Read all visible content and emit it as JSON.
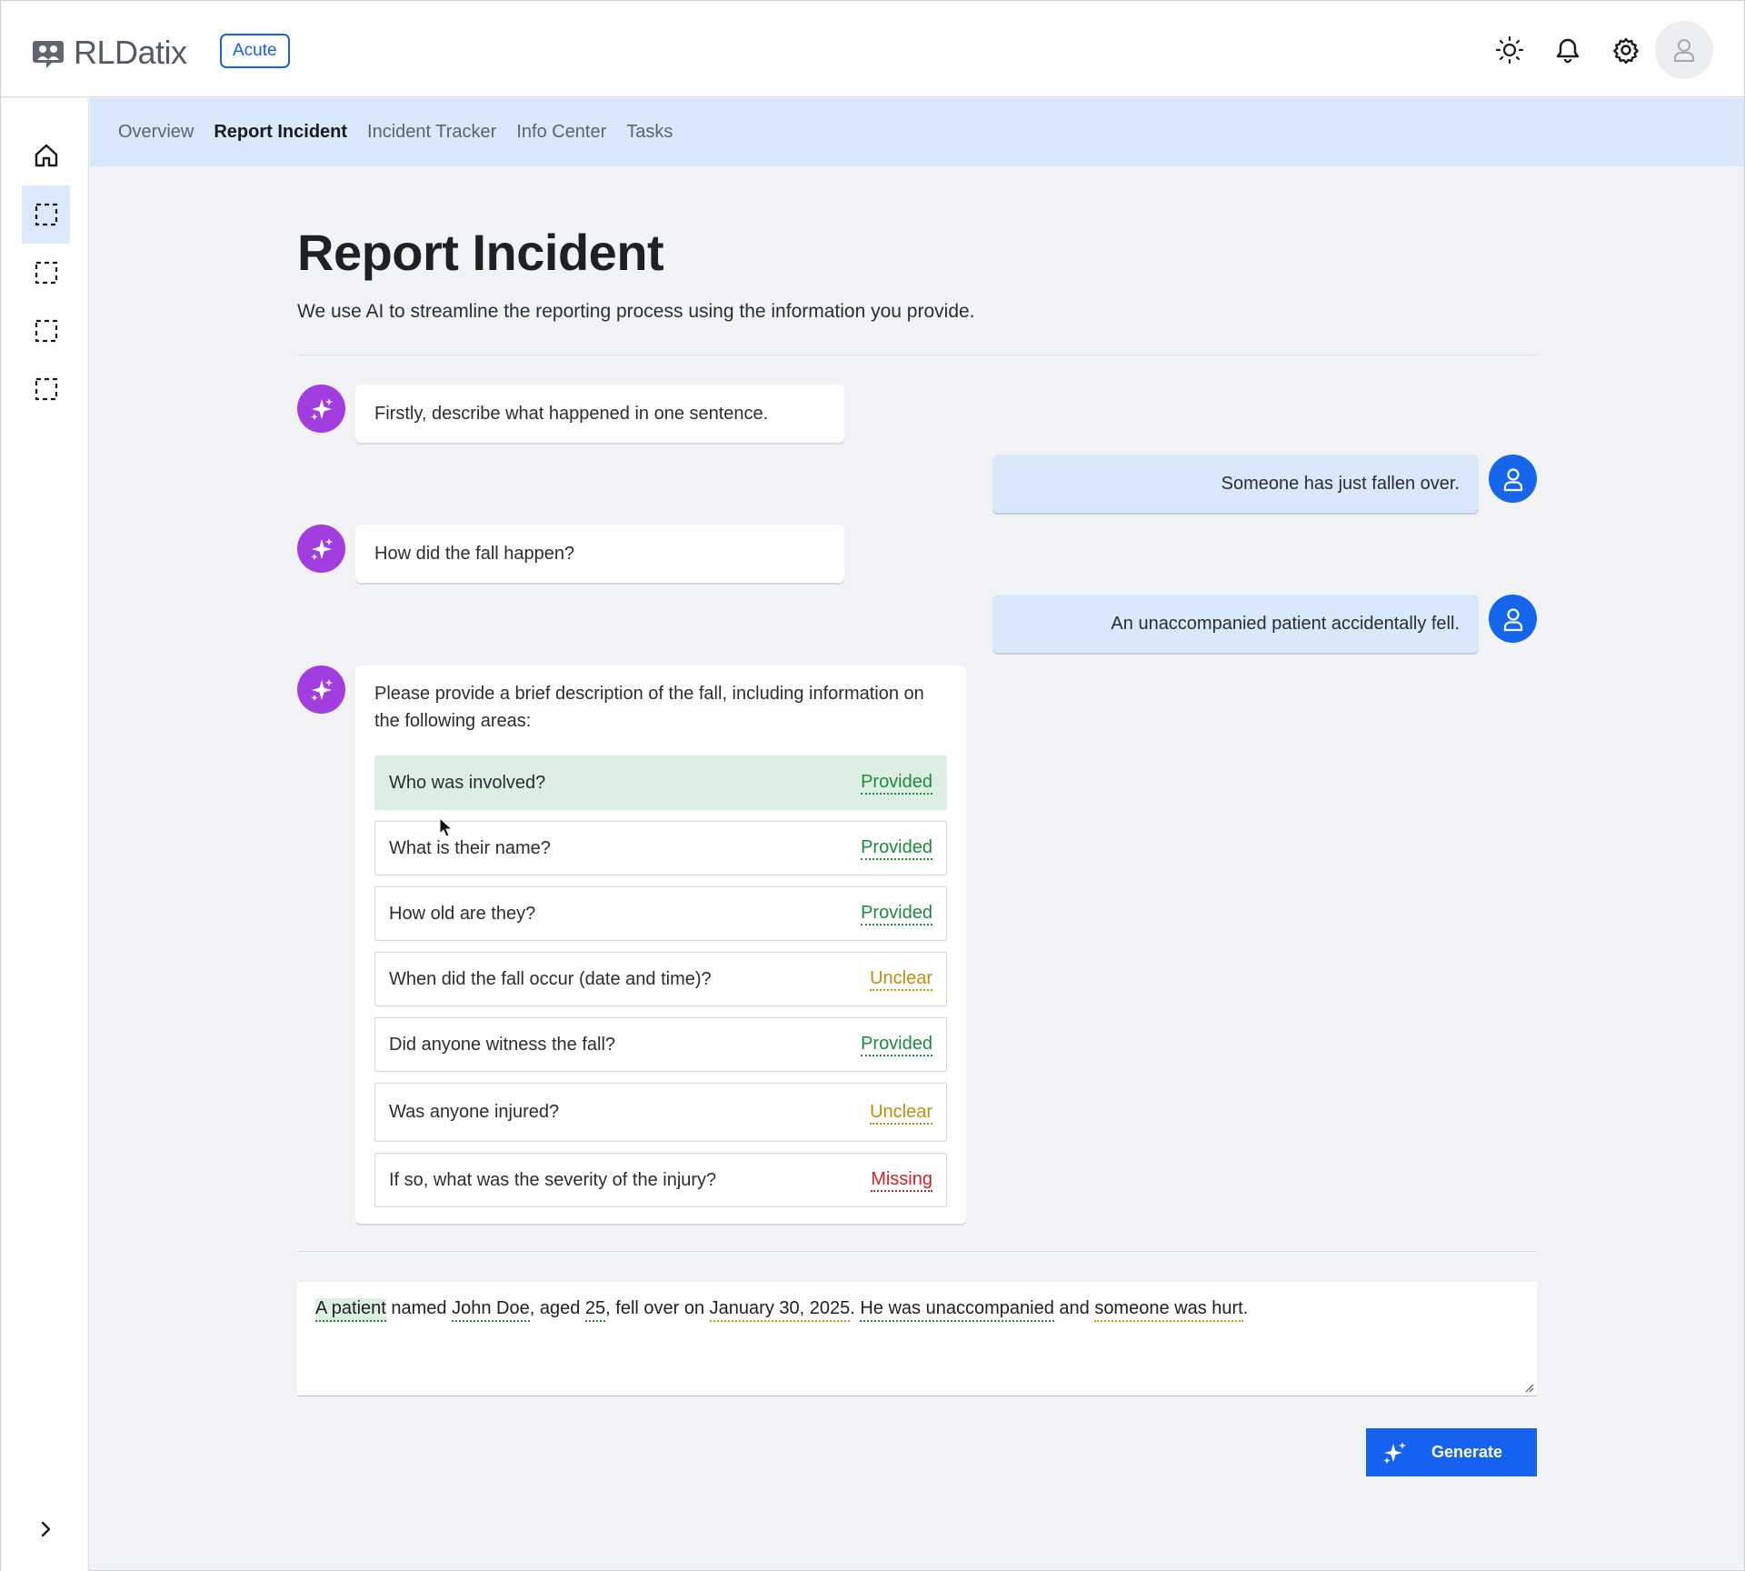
{
  "app": {
    "brand": "RLDatix",
    "badge": "Acute"
  },
  "header": {
    "icons": [
      "sun-icon",
      "bell-icon",
      "gear-icon",
      "user-avatar-icon"
    ]
  },
  "sidebar": {
    "items": [
      {
        "icon": "home-icon"
      },
      {
        "icon": "placeholder-icon",
        "active": true
      },
      {
        "icon": "placeholder-icon"
      },
      {
        "icon": "placeholder-icon"
      },
      {
        "icon": "placeholder-icon"
      }
    ],
    "expand_icon": "chevron-right-icon"
  },
  "subnav": {
    "items": [
      {
        "label": "Overview"
      },
      {
        "label": "Report Incident",
        "active": true
      },
      {
        "label": "Incident Tracker"
      },
      {
        "label": "Info Center"
      },
      {
        "label": "Tasks"
      }
    ]
  },
  "page": {
    "title": "Report Incident",
    "subtitle": "We use AI to streamline the reporting process using the information you provide."
  },
  "chat": {
    "q1": "Firstly, describe what happened in one sentence.",
    "a1": "Someone has just fallen over.",
    "q2": "How did the fall happen?",
    "a2": "An unaccompanied patient accidentally fell.",
    "q3_intro": "Please provide a brief description of the fall, including information on the following areas:",
    "checklist": [
      {
        "question": "Who was involved?",
        "status": "Provided"
      },
      {
        "question": "What is their name?",
        "status": "Provided"
      },
      {
        "question": "How old are they?",
        "status": "Provided"
      },
      {
        "question": "When did the fall occur (date and time)?",
        "status": "Unclear"
      },
      {
        "question": "Did anyone witness the fall?",
        "status": "Provided"
      },
      {
        "question": "Was anyone injured?",
        "status": "Unclear"
      },
      {
        "question": "If so, what was the severity of the injury?",
        "status": "Missing"
      }
    ]
  },
  "composer": {
    "tokens": [
      {
        "text": "A patient"
      },
      {
        "text": " named "
      },
      {
        "text": "John Doe"
      },
      {
        "text": ", aged "
      },
      {
        "text": "25"
      },
      {
        "text": ", fell over on "
      },
      {
        "text": "January 30, 2025"
      },
      {
        "text": ". "
      },
      {
        "text": "He was unaccompanied"
      },
      {
        "text": " and "
      },
      {
        "text": "someone was hurt"
      },
      {
        "text": "."
      }
    ]
  },
  "actions": {
    "generate_label": "Generate"
  },
  "colors": {
    "primary": "#1462ef",
    "ai_avatar": "#a23de0",
    "provided": "#1f8a3a",
    "unclear": "#c08f0a",
    "missing": "#d0222b",
    "subnav_bg": "#dae8fb"
  }
}
